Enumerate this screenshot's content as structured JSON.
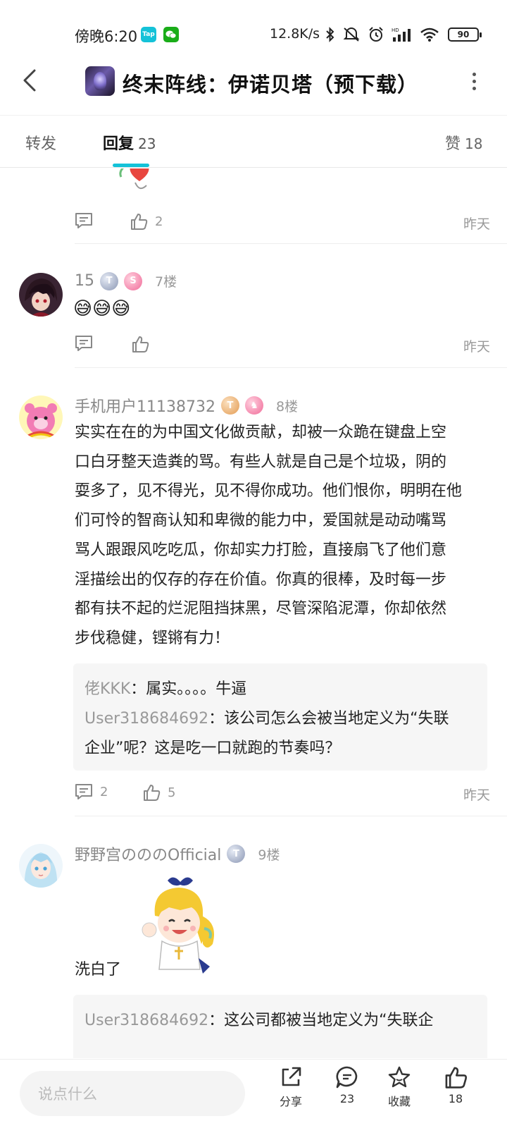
{
  "status_bar": {
    "time": "傍晚6:20",
    "app_icons": [
      "TapTap",
      "WeChat"
    ],
    "tap_label": "Tap",
    "network_speed": "12.8K/s",
    "battery": "90"
  },
  "header": {
    "title": "终末阵线：伊诺贝塔（预下载）"
  },
  "tabs": {
    "forward": "转发",
    "reply": "回复",
    "reply_count": "23",
    "like": "赞",
    "like_count": "18"
  },
  "prev_comment": {
    "like_count": "2",
    "time": "昨天"
  },
  "comments": [
    {
      "username": "15",
      "floor": "7楼",
      "text": "😅😅😅",
      "like_count": "",
      "reply_count": "",
      "time": "昨天"
    },
    {
      "username": "手机用户11138732",
      "floor": "8楼",
      "lines": [
        "实实在在的为中国文化做贡献，却被一众跪在键盘上空",
        "口白牙整天造粪的骂。有些人就是自己是个垃圾，阴的",
        "耍多了，见不得光，见不得你成功。他们恨你，明明在他",
        "们可怜的智商认知和卑微的能力中，爱国就是动动嘴骂",
        "骂人跟跟风吃吃瓜，你却实力打脸，直接扇飞了他们意",
        "淫描绘出的仅存的存在价值。你真的很棒，及时每一步",
        "都有扶不起的烂泥阻挡抹黑，尽管深陷泥潭，你却依然",
        "步伐稳健，铿锵有力！"
      ],
      "replies": [
        {
          "user": "佬KKK",
          "text": "：属实。。。。牛逼"
        },
        {
          "user": "User318684692",
          "text": "：该公司怎么会被当地定义为“失联"
        },
        {
          "user": "",
          "text": "企业”呢？这是吃一口就跑的节奏吗？"
        }
      ],
      "reply_count": "2",
      "like_count": "5",
      "time": "昨天"
    },
    {
      "username": "野野宫のののOfficial",
      "floor": "9楼",
      "text": "洗白了",
      "replies": [
        {
          "user": "User318684692",
          "text": "：这公司都被当地定义为“失联企"
        }
      ]
    }
  ],
  "bottom_bar": {
    "input_placeholder": "说点什么",
    "share": "分享",
    "comments": "23",
    "favorite": "收藏",
    "likes": "18"
  },
  "colors": {
    "accent": "#14c2d8",
    "muted": "#999999",
    "reply_bg": "#f6f6f6"
  }
}
